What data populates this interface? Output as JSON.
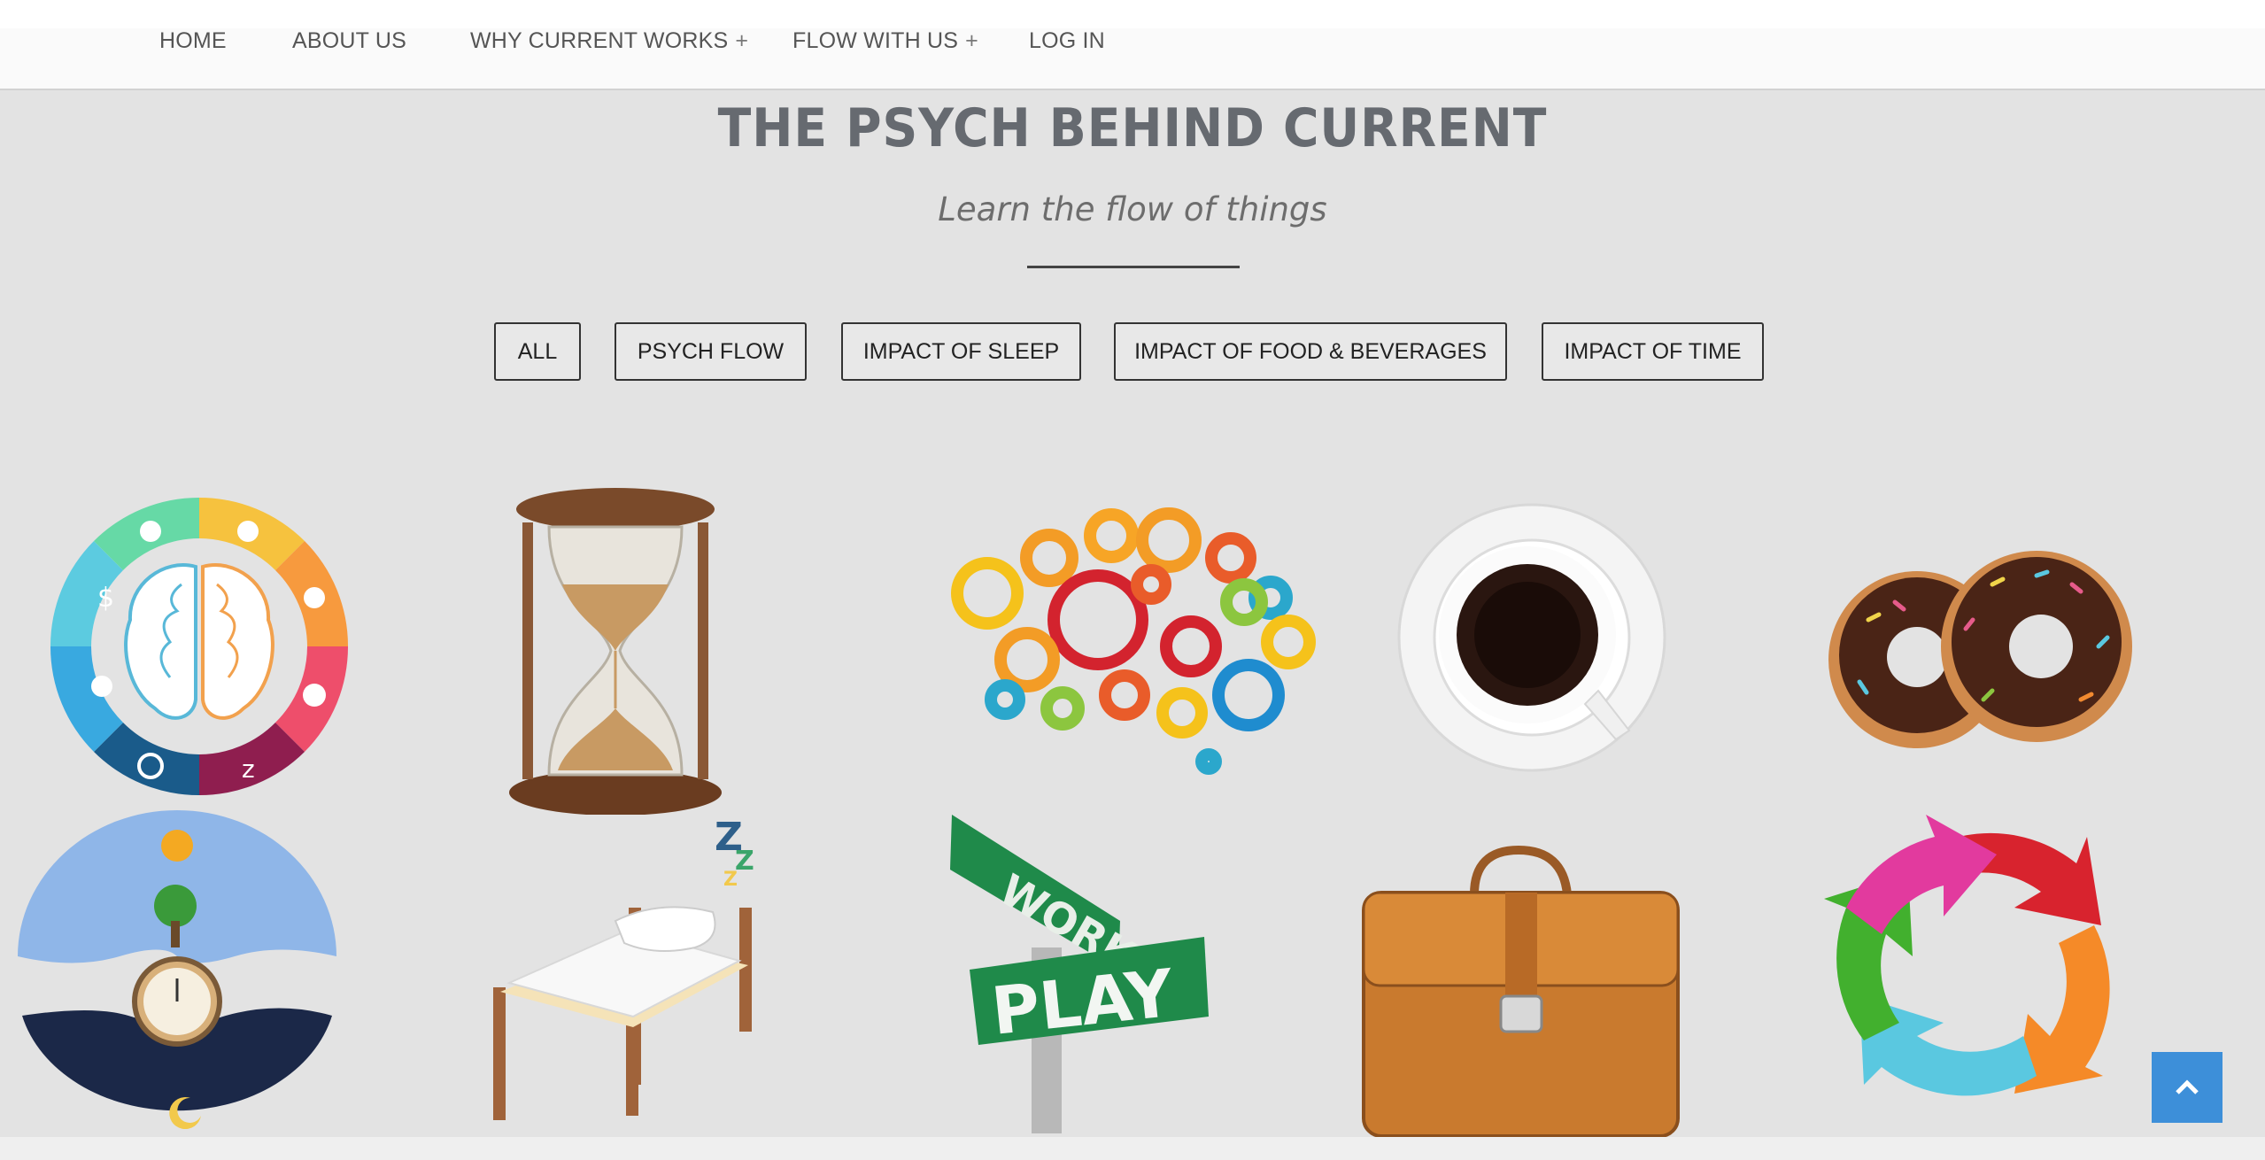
{
  "nav": {
    "items": [
      {
        "label": "HOME",
        "has_submenu": false
      },
      {
        "label": "ABOUT US",
        "has_submenu": false
      },
      {
        "label": "WHY CURRENT WORKS",
        "has_submenu": true
      },
      {
        "label": "FLOW WITH US",
        "has_submenu": true
      },
      {
        "label": "LOG IN",
        "has_submenu": false
      }
    ],
    "submenu_glyph": "+"
  },
  "header": {
    "title": "THE PSYCH BEHIND CURRENT",
    "subtitle": "Learn the flow of things"
  },
  "filters": [
    {
      "label": "ALL"
    },
    {
      "label": "PSYCH FLOW"
    },
    {
      "label": "IMPACT OF SLEEP"
    },
    {
      "label": "IMPACT OF FOOD & BEVERAGES"
    },
    {
      "label": "IMPACT OF TIME"
    }
  ],
  "gallery": {
    "items": [
      {
        "icon": "brain-hemispheres-icon"
      },
      {
        "icon": "hourglass-icon"
      },
      {
        "icon": "gear-brain-icon"
      },
      {
        "icon": "coffee-cup-icon"
      },
      {
        "icon": "donuts-icon"
      },
      {
        "icon": "day-night-clock-icon"
      },
      {
        "icon": "bed-sleep-icon"
      },
      {
        "icon": "work-play-sign-icon"
      },
      {
        "icon": "briefcase-icon"
      },
      {
        "icon": "cycle-arrows-icon"
      }
    ],
    "sign_work": "WORK",
    "sign_play": "PLAY",
    "sleep_text": "Z"
  },
  "colors": {
    "background": "#e3e3e3",
    "nav_bg": "#fafafa",
    "title": "#666a70",
    "scroll_button": "#3d8fd9"
  }
}
